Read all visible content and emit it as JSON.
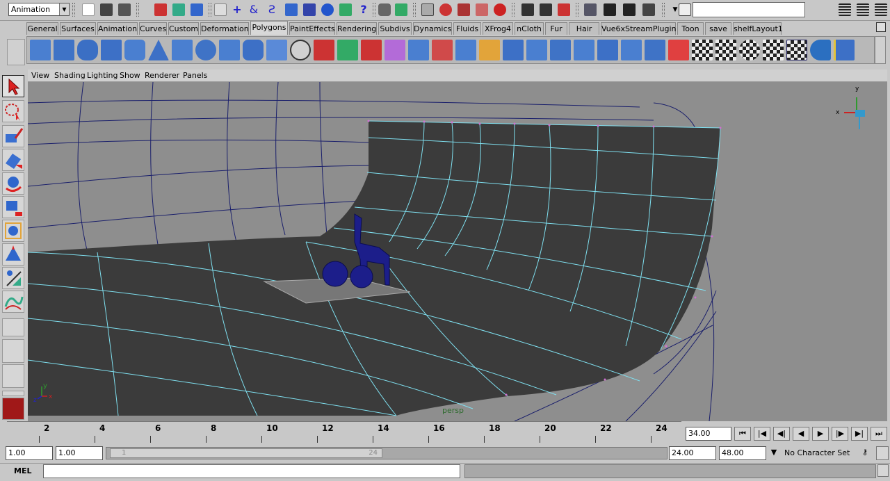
{
  "status_line": {
    "mode": "Animation",
    "input_value": ""
  },
  "shelf": {
    "tabs": [
      {
        "label": "General"
      },
      {
        "label": "Surfaces"
      },
      {
        "label": "Animation"
      },
      {
        "label": "Curves"
      },
      {
        "label": "Custom"
      },
      {
        "label": "Deformation"
      },
      {
        "label": "Polygons"
      },
      {
        "label": "PaintEffects"
      },
      {
        "label": "Rendering"
      },
      {
        "label": "Subdivs"
      },
      {
        "label": "Dynamics"
      },
      {
        "label": "Fluids"
      },
      {
        "label": "XFrog4"
      },
      {
        "label": "nCloth"
      },
      {
        "label": "Fur"
      },
      {
        "label": "Hair"
      },
      {
        "label": "Vue6xStreamPlugin"
      },
      {
        "label": "Toon"
      },
      {
        "label": "save"
      },
      {
        "label": "shelfLayout1"
      }
    ],
    "active_tab": "Polygons"
  },
  "panel_menu": {
    "items": [
      "View",
      "Shading",
      "Lighting",
      "Show",
      "Renderer",
      "Panels"
    ]
  },
  "viewport": {
    "camera_label": "persp",
    "axis_x": "x",
    "axis_y": "y",
    "axis_z": "z",
    "corner_axis_y": "y",
    "corner_axis_x": "x",
    "colors": {
      "background": "#8e8e8e",
      "surface": "#3b3b3b",
      "wire_dark": "#1a1f6b",
      "wire_light": "#7fe0f0",
      "object": "#1c1e8a"
    }
  },
  "timeline": {
    "ticks": [
      "2",
      "4",
      "6",
      "8",
      "10",
      "12",
      "14",
      "16",
      "18",
      "20",
      "22",
      "24"
    ],
    "current_time": "34.00"
  },
  "range_slider": {
    "start_time": "1.00",
    "playback_start": "1.00",
    "range_start_label": "1",
    "range_end_label": "24",
    "playback_end": "24.00",
    "end_time": "48.00",
    "character_set": "No Character Set"
  },
  "command_line": {
    "label": "MEL",
    "input_value": ""
  }
}
